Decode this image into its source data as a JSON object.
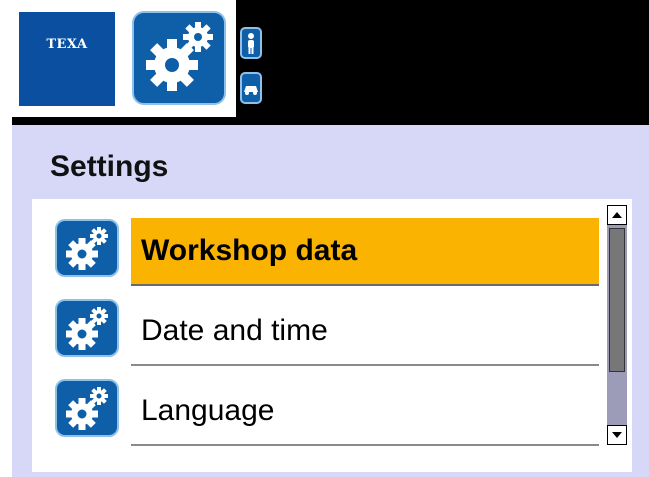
{
  "header": {
    "logo_text": "TEXA",
    "main_icon": "gears-icon",
    "small_buttons": [
      {
        "icon": "person-icon"
      },
      {
        "icon": "car-icon"
      }
    ]
  },
  "page": {
    "title": "Settings"
  },
  "menu": {
    "selected_index": 0,
    "items": [
      {
        "label": "Workshop data",
        "icon": "gears-icon"
      },
      {
        "label": "Date and time",
        "icon": "gears-icon"
      },
      {
        "label": "Language",
        "icon": "gears-icon"
      }
    ]
  },
  "colors": {
    "brand_blue": "#0a4fa0",
    "icon_blue": "#0f5ea8",
    "selection": "#f9b300",
    "panel_bg": "#d7d7f7"
  }
}
